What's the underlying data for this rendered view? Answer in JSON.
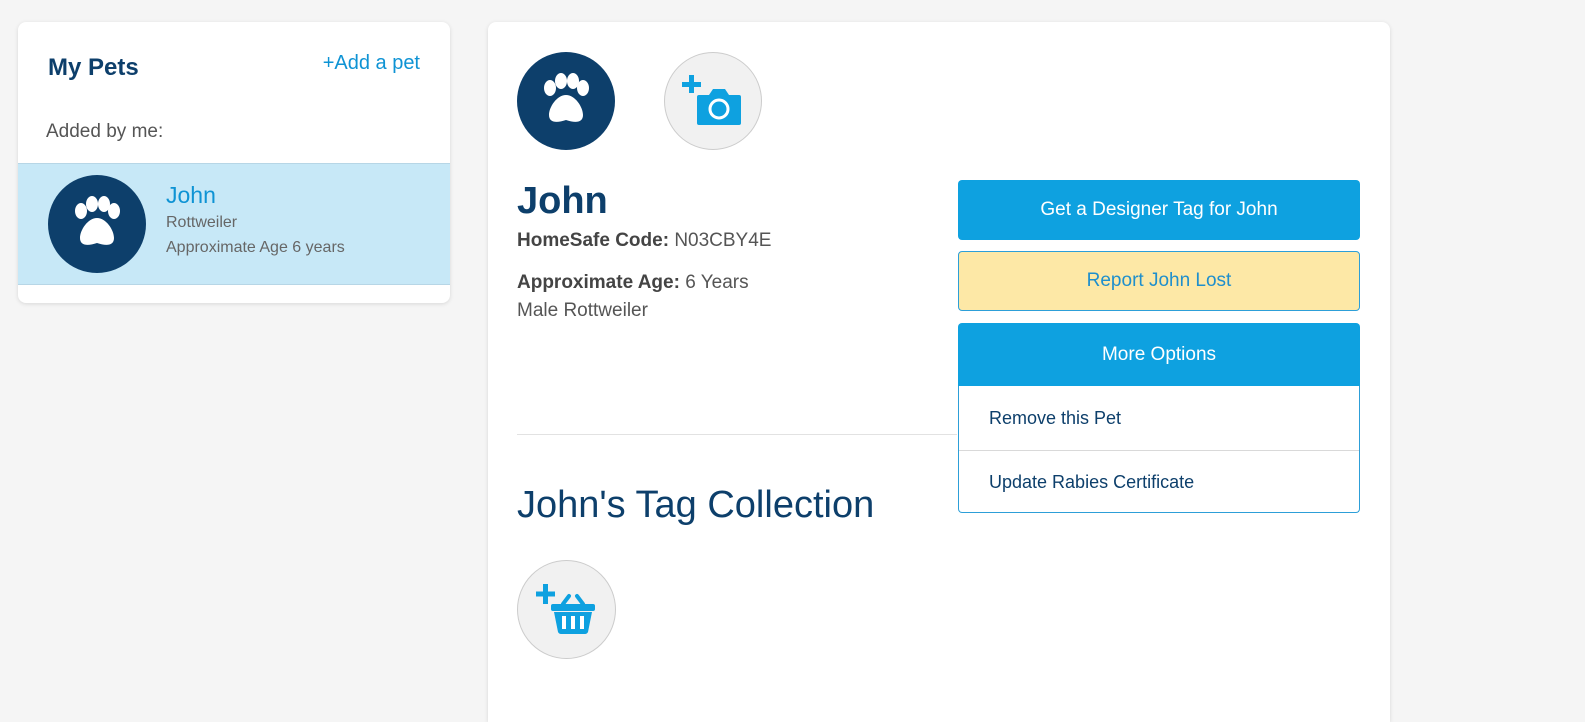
{
  "sidebar": {
    "title": "My Pets",
    "add_pet": "+Add a pet",
    "section_label": "Added by me:",
    "pets": [
      {
        "name": "John",
        "breed": "Rottweiler",
        "age": "Approximate Age 6 years"
      }
    ]
  },
  "pet": {
    "name": "John",
    "code_label": "HomeSafe Code:",
    "code_value": "N03CBY4E",
    "age_label": "Approximate Age:",
    "age_value": "6 Years",
    "description": "Male Rottweiler"
  },
  "actions": {
    "designer_tag": "Get a Designer Tag for John",
    "report_lost": "Report John Lost",
    "more_options": "More Options",
    "menu": [
      "Remove this Pet",
      "Update Rabies Certificate"
    ]
  },
  "tags": {
    "title": "John's Tag Collection"
  },
  "icons": {
    "avatar": "paw-icon",
    "photo": "add-photo-icon",
    "basket": "add-basket-icon"
  },
  "colors": {
    "navy": "#0d3f6b",
    "accent": "#0ea1e0",
    "lost_bg": "#fde8a6",
    "selected_bg": "#c7e8f7"
  }
}
